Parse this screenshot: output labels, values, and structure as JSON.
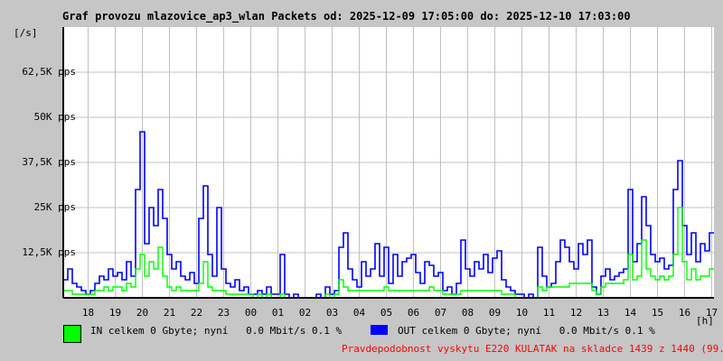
{
  "chart_data": {
    "type": "line",
    "title": "Graf provozu mlazovice_ap3_wlan Packets od: 2025-12-09 17:05:00 do: 2025-12-10 17:03:00",
    "ylabel": "[/s]",
    "xlabel": "[h]",
    "ylim": [
      0,
      75000
    ],
    "y_ticks": [
      12500,
      25000,
      37500,
      50000,
      62500
    ],
    "y_tick_labels": [
      "12,5K pps",
      "25K pps",
      "37,5K pps",
      "50K pps",
      "62,5K pps"
    ],
    "x_tick_labels": [
      "18",
      "19",
      "20",
      "21",
      "22",
      "23",
      "00",
      "01",
      "02",
      "03",
      "04",
      "05",
      "06",
      "07",
      "08",
      "09",
      "10",
      "11",
      "12",
      "13",
      "14",
      "15",
      "16",
      "17"
    ],
    "x_start_time": "17:05",
    "sample_interval_min": 10,
    "grid": true,
    "series": [
      {
        "name": "IN",
        "color": "#00ff00",
        "unit": "K pps",
        "values": [
          2,
          2,
          1,
          1,
          1,
          1,
          1,
          2,
          2,
          3,
          2,
          3,
          3,
          2,
          4,
          3,
          8,
          12,
          6,
          10,
          8,
          14,
          6,
          3,
          2,
          3,
          2,
          2,
          2,
          2,
          4,
          10,
          3,
          2,
          2,
          2,
          1,
          1,
          1,
          1,
          1,
          1,
          0,
          1,
          0,
          1,
          0,
          0,
          1,
          0,
          0,
          0,
          0,
          0,
          0,
          0,
          0,
          0,
          1,
          0,
          1,
          5,
          3,
          2,
          2,
          2,
          2,
          2,
          2,
          2,
          2,
          3,
          2,
          2,
          2,
          2,
          2,
          2,
          2,
          2,
          2,
          3,
          2,
          2,
          1,
          1,
          1,
          1,
          2,
          2,
          2,
          2,
          2,
          2,
          2,
          2,
          2,
          1,
          1,
          1,
          0,
          0,
          0,
          0,
          0,
          3,
          2,
          3,
          3,
          3,
          3,
          3,
          4,
          4,
          4,
          4,
          4,
          2,
          1,
          3,
          4,
          4,
          4,
          4,
          5,
          12,
          5,
          6,
          16,
          8,
          6,
          5,
          6,
          5,
          6,
          12,
          25,
          10,
          5,
          8,
          5,
          6,
          6,
          8
        ]
      },
      {
        "name": "OUT",
        "color": "#0000ff",
        "unit": "K pps",
        "values": [
          5,
          8,
          4,
          3,
          2,
          1,
          2,
          4,
          6,
          5,
          8,
          6,
          7,
          5,
          10,
          6,
          30,
          46,
          15,
          25,
          20,
          30,
          22,
          12,
          8,
          10,
          6,
          5,
          7,
          4,
          22,
          31,
          12,
          6,
          25,
          8,
          4,
          3,
          5,
          2,
          3,
          1,
          1,
          2,
          1,
          3,
          1,
          1,
          12,
          1,
          0,
          1,
          0,
          0,
          0,
          0,
          1,
          0,
          3,
          1,
          2,
          14,
          18,
          8,
          5,
          3,
          10,
          6,
          8,
          15,
          6,
          14,
          4,
          12,
          6,
          10,
          11,
          12,
          7,
          4,
          10,
          9,
          6,
          7,
          2,
          3,
          1,
          4,
          16,
          8,
          6,
          10,
          8,
          12,
          7,
          11,
          13,
          5,
          3,
          2,
          1,
          1,
          0,
          1,
          0,
          14,
          6,
          3,
          4,
          10,
          16,
          14,
          10,
          8,
          15,
          12,
          16,
          3,
          1,
          6,
          8,
          5,
          6,
          7,
          8,
          30,
          10,
          15,
          28,
          20,
          12,
          10,
          11,
          8,
          9,
          30,
          38,
          20,
          12,
          18,
          10,
          15,
          13,
          18
        ]
      }
    ]
  },
  "legend": {
    "in_text": "IN celkem 0 Gbyte; nyní   0.0 Mbit/s 0.1 %",
    "out_text": "OUT celkem 0 Gbyte; nyní   0.0 Mbit/s 0.1 %"
  },
  "note": "Pravdepodobnost vyskytu E220 KULATAK na skladce 1439 z 1440 (99.9 %)"
}
